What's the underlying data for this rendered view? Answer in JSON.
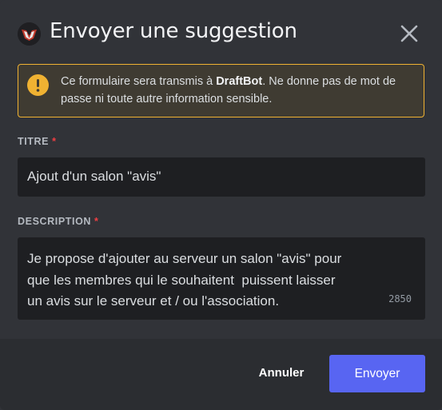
{
  "modal": {
    "title": "Envoyer une suggestion",
    "icon": "draftbot-logo-icon"
  },
  "notice": {
    "icon": "warning-icon",
    "text_before": "Ce formulaire sera transmis à ",
    "bot_name": "DraftBot",
    "text_after": ". Ne donne pas de mot de passe ni toute autre information sensible."
  },
  "fields": {
    "title": {
      "label": "TITRE",
      "required_mark": "*",
      "value": "Ajout d'un salon \"avis\""
    },
    "description": {
      "label": "DESCRIPTION",
      "required_mark": "*",
      "value_lines": [
        "Je propose d'ajouter au serveur un salon \"avis\" pour",
        "que les membres qui le souhaitent  puissent laisser",
        "un avis sur le serveur et / ou l'association."
      ],
      "remaining_chars": "2850"
    }
  },
  "footer": {
    "cancel_label": "Annuler",
    "submit_label": "Envoyer"
  },
  "colors": {
    "background": "#313338",
    "footer": "#2b2d31",
    "input": "#1e1f22",
    "warning": "#f0b232",
    "required": "#f23f43",
    "brand": "#5865f2"
  }
}
